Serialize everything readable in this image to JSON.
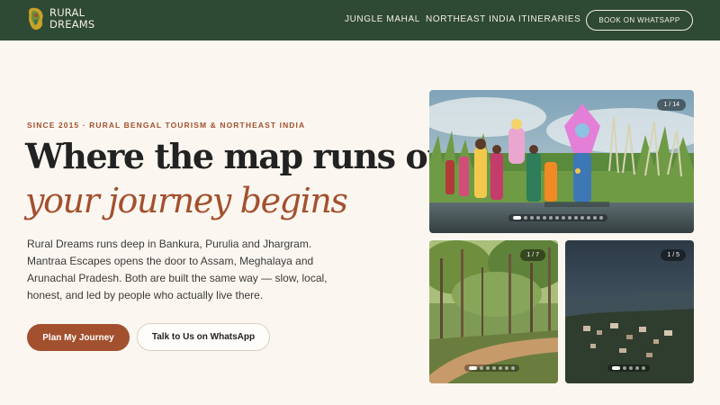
{
  "brand": {
    "line1": "RURAL",
    "line2": "DREAMS"
  },
  "nav": {
    "links": [
      "JUNGLE MAHAL",
      "NORTHEAST INDIA",
      "ITINERARIES"
    ],
    "cta": "BOOK ON WHATSAPP"
  },
  "hero": {
    "eyebrow": "SINCE 2015 · RURAL BENGAL TOURISM & NORTHEAST INDIA",
    "headline_line1": "Where the map runs out,",
    "headline_line2": "your journey begins",
    "lead": "Rural Dreams runs deep in Bankura, Purulia and Jhargram. Mantraa Escapes opens the door to Assam, Meghalaya and Arunachal Pradesh. Both are built the same way — slow, local, honest, and led by people who actually live there.",
    "primary_button": "Plan My Journey",
    "secondary_button": "Talk to Us on WhatsApp"
  },
  "gallery": {
    "main": {
      "counter": "1 / 14",
      "slides": 14,
      "active": 1
    },
    "forest": {
      "counter": "1 / 7",
      "slides": 7,
      "active": 1
    },
    "hills": {
      "counter": "1 / 5",
      "slides": 5,
      "active": 1
    }
  },
  "colors": {
    "header": "#2f4a34",
    "accent": "#a3502e",
    "background": "#fbf7f0"
  }
}
